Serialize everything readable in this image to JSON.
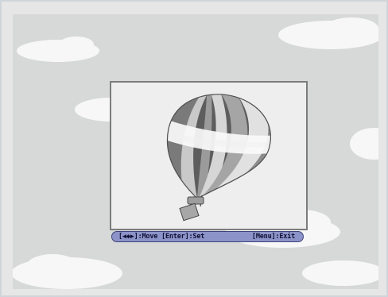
{
  "colors": {
    "background": "#e6e6e6",
    "sky": "#d7d9d9",
    "cloud": "#f7f7f7",
    "frame_border": "#7c7c7c",
    "hint_bar": "#8c93c8",
    "hint_text": "#0f1235"
  },
  "preview": {
    "image_icon": "hot-air-balloon-icon"
  },
  "hint_bar": {
    "left_text": "[◀◆▶]:Move [Enter]:Set",
    "right_text": "[Menu]:Exit"
  }
}
